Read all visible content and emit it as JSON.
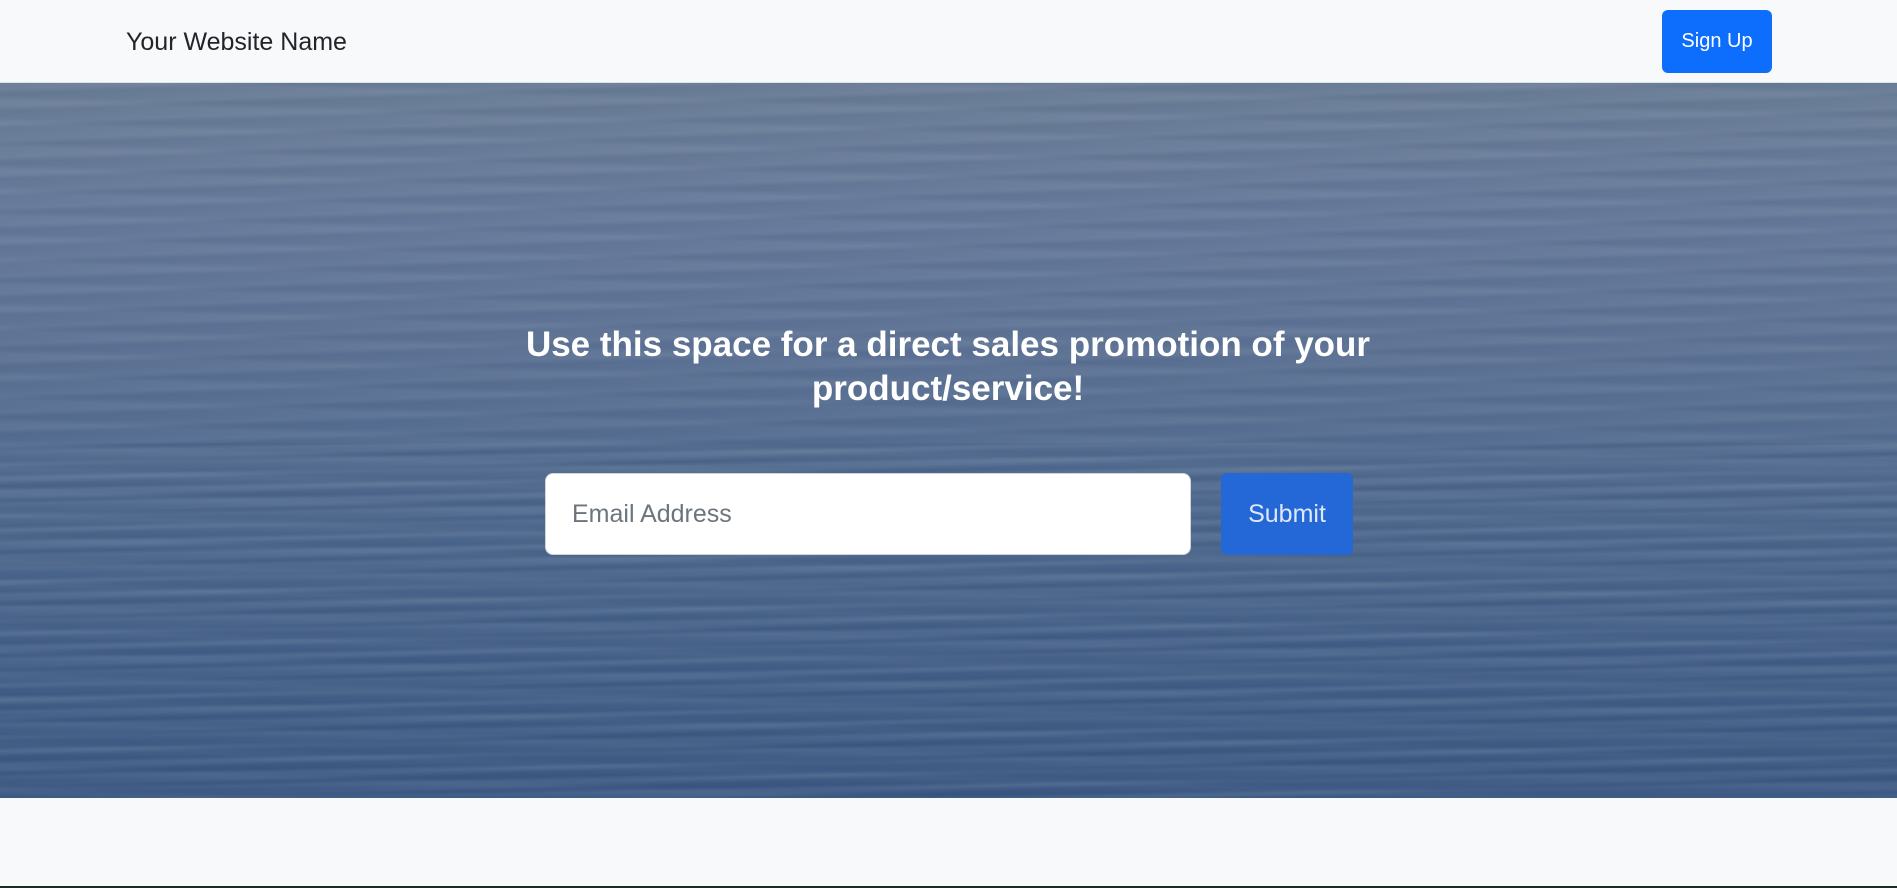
{
  "navbar": {
    "brand": "Your Website Name",
    "signup_label": "Sign Up"
  },
  "hero": {
    "headline": "Use this space for a direct sales promotion of your product/service!",
    "email_placeholder": "Email Address",
    "email_value": "",
    "submit_label": "Submit"
  },
  "colors": {
    "primary": "#0d6efd",
    "navbar_bg": "#f8f9fa",
    "text_dark": "#212529",
    "hero_top": "#6b7e97",
    "hero_bottom": "#3e5b85"
  },
  "icons": []
}
